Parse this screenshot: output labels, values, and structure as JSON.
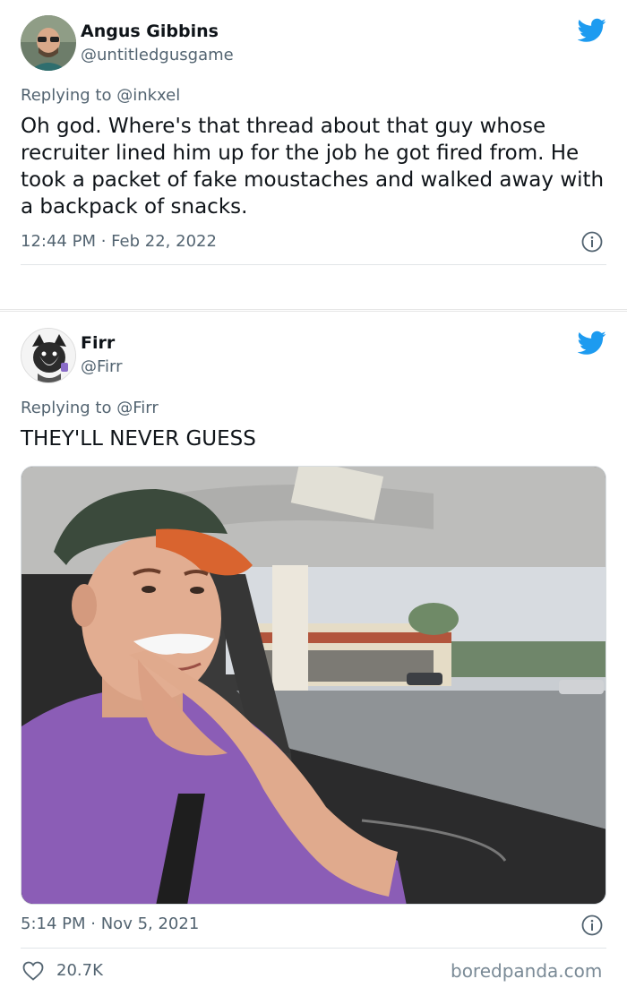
{
  "tweet1": {
    "display_name": "Angus Gibbins",
    "handle": "@untitledgusgame",
    "reply_prefix": "Replying to",
    "reply_to": "@inkxel",
    "text": "Oh god. Where's that thread about that guy whose recruiter lined him up for the job he got fired from. He took a packet of fake moustaches and walked away with a backpack of snacks.",
    "time": "12:44 PM",
    "date": "Feb 22, 2022"
  },
  "tweet2": {
    "display_name": "Firr",
    "handle": "@Firr",
    "reply_prefix": "Replying to",
    "reply_to": "@Firr",
    "text": "THEY'LL NEVER GUESS",
    "time": "5:14 PM",
    "date": "Nov 5, 2021",
    "likes": "20.7K"
  },
  "watermark": "boredpanda.com",
  "colors": {
    "twitter_blue": "#1d9bf0",
    "muted_text": "#536471",
    "primary_text": "#0f1419"
  },
  "icons": [
    "twitter-bird-icon",
    "info-icon",
    "heart-icon"
  ]
}
